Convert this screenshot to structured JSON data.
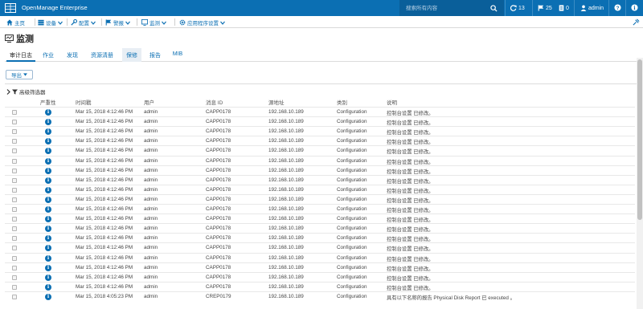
{
  "app": {
    "title": "OpenManage Enterprise"
  },
  "search": {
    "placeholder": "搜索所有内容"
  },
  "topbar": {
    "jobs_count": "13",
    "alerts_count": "25",
    "warranty_count": "0",
    "user": "admin"
  },
  "nav": {
    "home": "主页",
    "devices": "设备",
    "configuration": "配置",
    "alerts": "警报",
    "monitor": "监测",
    "app_settings": "应用程序设置"
  },
  "page": {
    "title": "监测"
  },
  "tabs": [
    "审计日志",
    "作业",
    "发现",
    "资源清册",
    "保修",
    "报告",
    "MIB"
  ],
  "toolbar": {
    "export_label": "导出"
  },
  "filter": {
    "label": "高级筛选器"
  },
  "table": {
    "columns": [
      "严重性",
      "时间戳",
      "用户",
      "消息 ID",
      "源地址",
      "类别",
      "说明"
    ],
    "rows": [
      {
        "timestamp": "Mar 15, 2018 4:12:46 PM",
        "user": "admin",
        "message_id": "CAPP0178",
        "source": "192.168.10.189",
        "category": "Configuration",
        "description": "控制台设置 已修改。"
      },
      {
        "timestamp": "Mar 15, 2018 4:12:46 PM",
        "user": "admin",
        "message_id": "CAPP0178",
        "source": "192.168.10.189",
        "category": "Configuration",
        "description": "控制台设置 已修改。"
      },
      {
        "timestamp": "Mar 15, 2018 4:12:46 PM",
        "user": "admin",
        "message_id": "CAPP0178",
        "source": "192.168.10.189",
        "category": "Configuration",
        "description": "控制台设置 已修改。"
      },
      {
        "timestamp": "Mar 15, 2018 4:12:46 PM",
        "user": "admin",
        "message_id": "CAPP0178",
        "source": "192.168.10.189",
        "category": "Configuration",
        "description": "控制台设置 已修改。"
      },
      {
        "timestamp": "Mar 15, 2018 4:12:46 PM",
        "user": "admin",
        "message_id": "CAPP0178",
        "source": "192.168.10.189",
        "category": "Configuration",
        "description": "控制台设置 已修改。"
      },
      {
        "timestamp": "Mar 15, 2018 4:12:46 PM",
        "user": "admin",
        "message_id": "CAPP0178",
        "source": "192.168.10.189",
        "category": "Configuration",
        "description": "控制台设置 已修改。"
      },
      {
        "timestamp": "Mar 15, 2018 4:12:46 PM",
        "user": "admin",
        "message_id": "CAPP0178",
        "source": "192.168.10.189",
        "category": "Configuration",
        "description": "控制台设置 已修改。"
      },
      {
        "timestamp": "Mar 15, 2018 4:12:46 PM",
        "user": "admin",
        "message_id": "CAPP0178",
        "source": "192.168.10.189",
        "category": "Configuration",
        "description": "控制台设置 已修改。"
      },
      {
        "timestamp": "Mar 15, 2018 4:12:46 PM",
        "user": "admin",
        "message_id": "CAPP0178",
        "source": "192.168.10.189",
        "category": "Configuration",
        "description": "控制台设置 已修改。"
      },
      {
        "timestamp": "Mar 15, 2018 4:12:46 PM",
        "user": "admin",
        "message_id": "CAPP0178",
        "source": "192.168.10.189",
        "category": "Configuration",
        "description": "控制台设置 已修改。"
      },
      {
        "timestamp": "Mar 15, 2018 4:12:46 PM",
        "user": "admin",
        "message_id": "CAPP0178",
        "source": "192.168.10.189",
        "category": "Configuration",
        "description": "控制台设置 已修改。"
      },
      {
        "timestamp": "Mar 15, 2018 4:12:46 PM",
        "user": "admin",
        "message_id": "CAPP0178",
        "source": "192.168.10.189",
        "category": "Configuration",
        "description": "控制台设置 已修改。"
      },
      {
        "timestamp": "Mar 15, 2018 4:12:46 PM",
        "user": "admin",
        "message_id": "CAPP0178",
        "source": "192.168.10.189",
        "category": "Configuration",
        "description": "控制台设置 已修改。"
      },
      {
        "timestamp": "Mar 15, 2018 4:12:46 PM",
        "user": "admin",
        "message_id": "CAPP0178",
        "source": "192.168.10.189",
        "category": "Configuration",
        "description": "控制台设置 已修改。"
      },
      {
        "timestamp": "Mar 15, 2018 4:12:46 PM",
        "user": "admin",
        "message_id": "CAPP0178",
        "source": "192.168.10.189",
        "category": "Configuration",
        "description": "控制台设置 已修改。"
      },
      {
        "timestamp": "Mar 15, 2018 4:12:46 PM",
        "user": "admin",
        "message_id": "CAPP0178",
        "source": "192.168.10.189",
        "category": "Configuration",
        "description": "控制台设置 已修改。"
      },
      {
        "timestamp": "Mar 15, 2018 4:12:46 PM",
        "user": "admin",
        "message_id": "CAPP0178",
        "source": "192.168.10.189",
        "category": "Configuration",
        "description": "控制台设置 已修改。"
      },
      {
        "timestamp": "Mar 15, 2018 4:12:46 PM",
        "user": "admin",
        "message_id": "CAPP0178",
        "source": "192.168.10.189",
        "category": "Configuration",
        "description": "控制台设置 已修改。"
      },
      {
        "timestamp": "Mar 15, 2018 4:12:46 PM",
        "user": "admin",
        "message_id": "CAPP0178",
        "source": "192.168.10.189",
        "category": "Configuration",
        "description": "控制台设置 已修改。"
      },
      {
        "timestamp": "Mar 15, 2018 4:05:23 PM",
        "user": "admin",
        "message_id": "CREP0179",
        "source": "192.168.10.189",
        "category": "Configuration",
        "description": "具有以下名称的报告 Physical Disk Report 已 executed 。"
      }
    ]
  },
  "colors": {
    "brand": "#0b6fb3",
    "search_bg": "#0a5f9a"
  }
}
